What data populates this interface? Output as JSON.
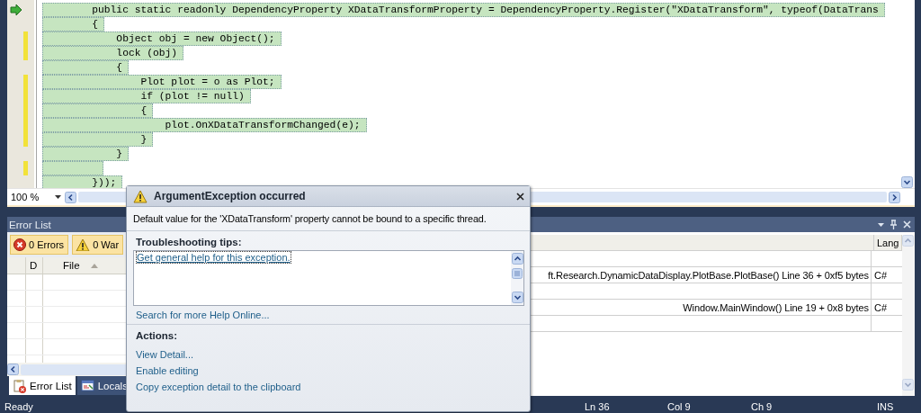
{
  "editor": {
    "code_lines": [
      {
        "text": "        public static readonly DependencyProperty XDataTransformProperty = DependencyProperty.Register(\"XDataTransform\", typeof(DataTrans",
        "highlighted": true,
        "changed": false,
        "current": true
      },
      {
        "text": "        {",
        "highlighted": true,
        "changed": false,
        "current": false
      },
      {
        "text": "            Object obj = new Object();",
        "highlighted": true,
        "changed": true,
        "current": false
      },
      {
        "text": "            lock (obj)",
        "highlighted": true,
        "changed": true,
        "current": false
      },
      {
        "text": "            {",
        "highlighted": true,
        "changed": false,
        "current": false
      },
      {
        "text": "                Plot plot = o as Plot;",
        "highlighted": true,
        "changed": true,
        "current": false
      },
      {
        "text": "                if (plot != null)",
        "highlighted": true,
        "changed": true,
        "current": false
      },
      {
        "text": "                {",
        "highlighted": true,
        "changed": true,
        "current": false
      },
      {
        "text": "                    plot.OnXDataTransformChanged(e);",
        "highlighted": true,
        "changed": true,
        "current": false
      },
      {
        "text": "                }",
        "highlighted": true,
        "changed": true,
        "current": false
      },
      {
        "text": "            }",
        "highlighted": true,
        "changed": false,
        "current": false
      },
      {
        "highlighted": true,
        "changed": true,
        "current": false
      },
      {
        "text": "        }));",
        "highlighted": true,
        "changed": false,
        "current": false
      }
    ],
    "zoom": "100 %"
  },
  "error_list": {
    "title": "Error List",
    "filters": [
      {
        "label": "0 Errors",
        "kind": "error",
        "selected": true
      },
      {
        "label": "0 War",
        "kind": "warning",
        "selected": true
      }
    ],
    "columns": [
      {
        "label": "D",
        "sorted": false
      },
      {
        "label": "File",
        "sorted": true
      }
    ]
  },
  "call_stack": {
    "columns": [
      {
        "label": "Lang"
      }
    ],
    "rows": [
      {},
      {
        "name": "ft.Research.DynamicDataDisplay.PlotBase.PlotBase() Line 36 + 0xf5 bytes",
        "language": "C#"
      },
      {},
      {
        "name": "Window.MainWindow() Line 19 + 0x8 bytes",
        "language": "C#"
      },
      {}
    ]
  },
  "bottom_tabs": [
    {
      "label": "Error List",
      "kind": "errors",
      "selected": true
    },
    {
      "label": "Locals",
      "kind": "locals",
      "selected": false
    }
  ],
  "exception_popup": {
    "title": "ArgumentException occurred",
    "message": "Default value for the 'XDataTransform' property cannot be bound to a specific thread.",
    "tips_heading": "Troubleshooting tips:",
    "tips": [
      {
        "text": "Get general help for this exception.",
        "focused": true
      }
    ],
    "help_link": "Search for more Help Online...",
    "actions_heading": "Actions:",
    "actions": [
      "View Detail...",
      "Enable editing",
      "Copy exception detail to the clipboard"
    ]
  },
  "status_bar": {
    "message": "Ready",
    "line": "Ln 36",
    "column": "Col 9",
    "char": "Ch 9",
    "mode": "INS"
  }
}
